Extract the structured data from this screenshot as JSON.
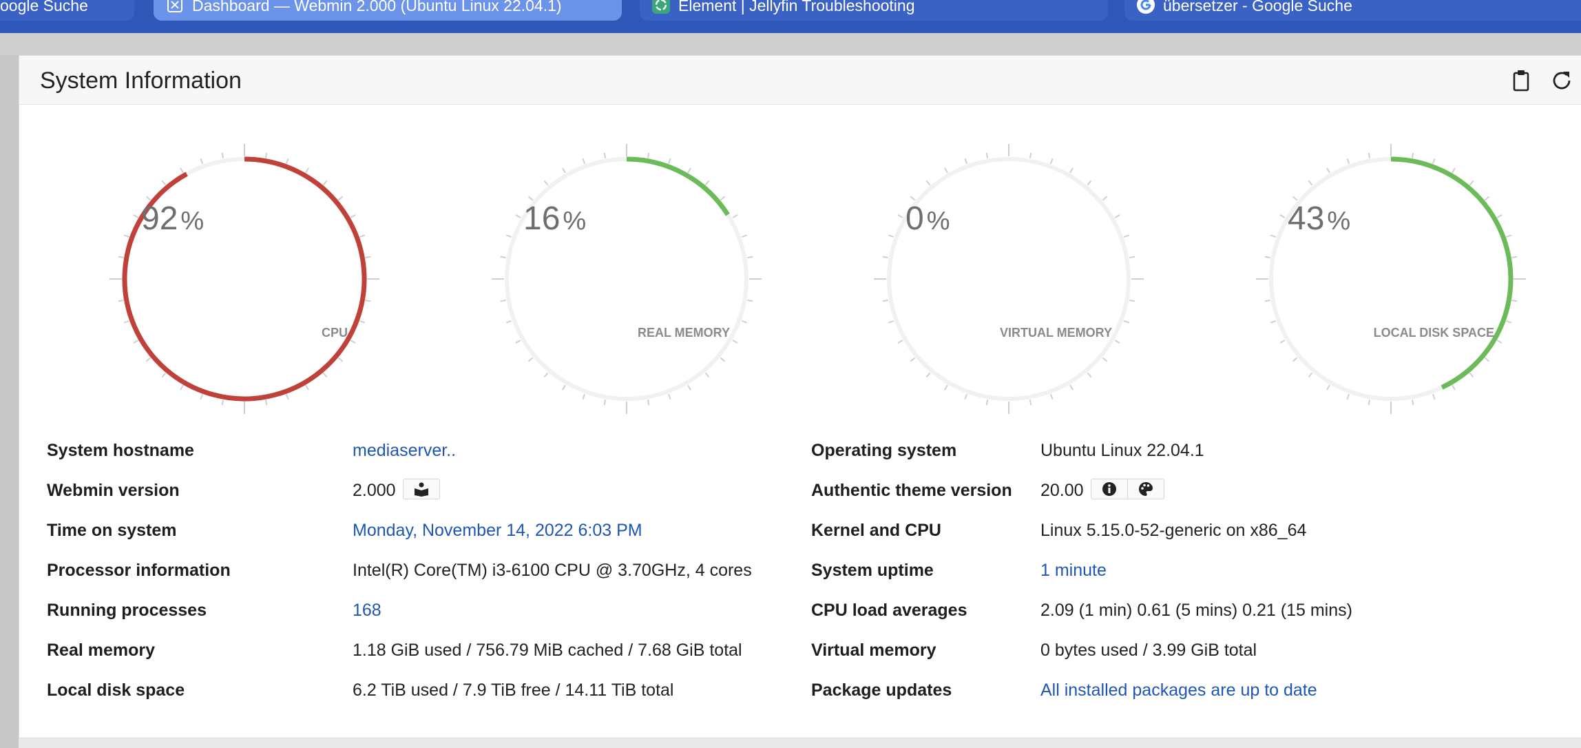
{
  "tabs": [
    {
      "label": "oogle Suche",
      "active": false
    },
    {
      "label": "Dashboard — Webmin 2.000 (Ubuntu Linux 22.04.1)",
      "active": true
    },
    {
      "label": "Element | Jellyfin Troubleshooting",
      "active": false
    },
    {
      "label": "übersetzer - Google Suche",
      "active": false
    }
  ],
  "panel": {
    "title": "System Information",
    "icons": [
      "clipboard-icon",
      "refresh-icon"
    ]
  },
  "gauges": [
    {
      "label": "CPU",
      "value": "92",
      "unit": "%",
      "percent": 92,
      "color": "#c0413a"
    },
    {
      "label": "REAL MEMORY",
      "value": "16",
      "unit": "%",
      "percent": 16,
      "color": "#6cbb5a"
    },
    {
      "label": "VIRTUAL MEMORY",
      "value": "0",
      "unit": "%",
      "percent": 0,
      "color": "#6cbb5a"
    },
    {
      "label": "LOCAL DISK SPACE",
      "value": "43",
      "unit": "%",
      "percent": 43,
      "color": "#6cbb5a"
    }
  ],
  "info_left": [
    {
      "label": "System hostname",
      "value": "mediaserver..",
      "link": true
    },
    {
      "label": "Webmin version",
      "value": "2.000",
      "link": false
    },
    {
      "label": "Time on system",
      "value": "Monday, November 14, 2022 6:03 PM",
      "link": true
    },
    {
      "label": "Processor information",
      "value": "Intel(R) Core(TM) i3-6100 CPU @ 3.70GHz, 4 cores",
      "link": false
    },
    {
      "label": "Running processes",
      "value": "168",
      "link": true
    },
    {
      "label": "Real memory",
      "value": "1.18 GiB used / 756.79 MiB cached / 7.68 GiB total",
      "link": false
    },
    {
      "label": "Local disk space",
      "value": "6.2 TiB used / 7.9 TiB free / 14.11 TiB total",
      "link": false
    }
  ],
  "info_right": [
    {
      "label": "Operating system",
      "value": "Ubuntu Linux 22.04.1",
      "link": false
    },
    {
      "label": "Authentic theme version",
      "value": "20.00",
      "link": false
    },
    {
      "label": "Kernel and CPU",
      "value": "Linux 5.15.0-52-generic on x86_64",
      "link": false
    },
    {
      "label": "System uptime",
      "value": "1 minute",
      "link": true
    },
    {
      "label": "CPU load averages",
      "value": "2.09 (1 min) 0.61 (5 mins) 0.21 (15 mins)",
      "link": false
    },
    {
      "label": "Virtual memory",
      "value": "0 bytes used / 3.99 GiB total",
      "link": false
    },
    {
      "label": "Package updates",
      "value": "All installed packages are up to date",
      "link": true
    }
  ],
  "colors": {
    "accent": "#2f57b8",
    "link": "#1f56b5",
    "danger": "#c0413a",
    "ok": "#6cbb5a"
  }
}
